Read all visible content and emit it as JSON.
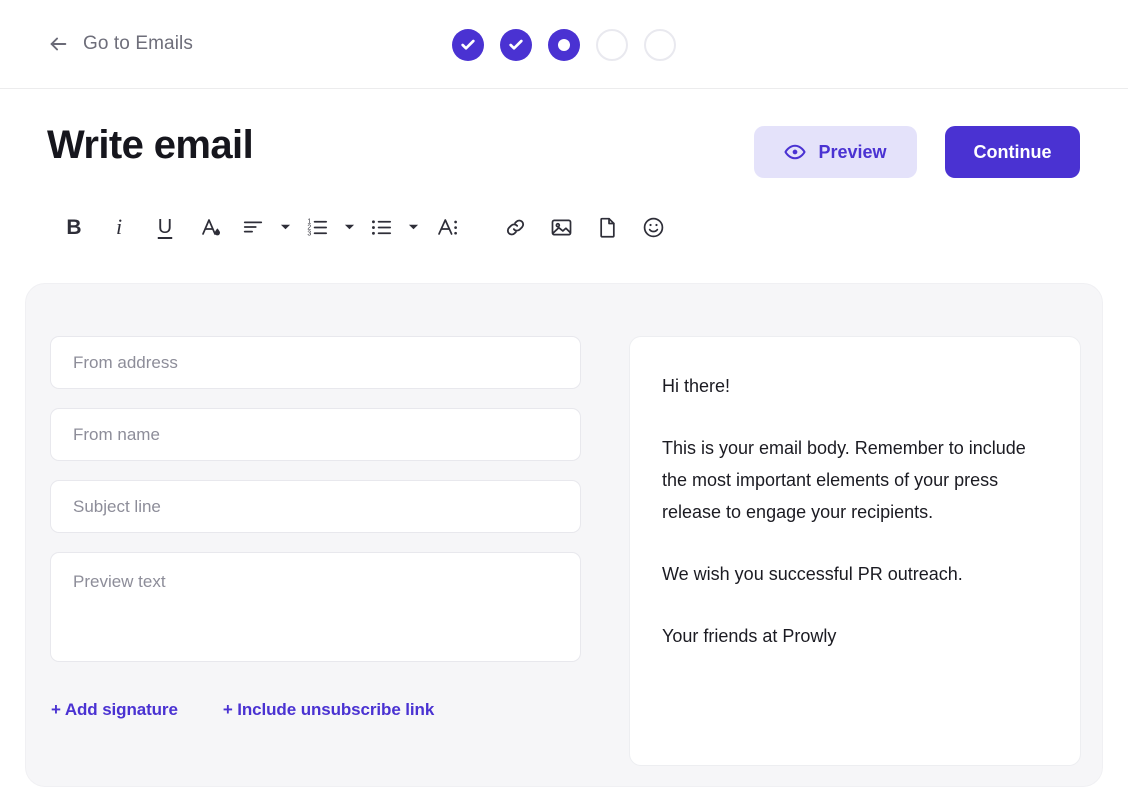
{
  "header": {
    "back_label": "Go to Emails",
    "back_icon": "arrow-left-icon",
    "steps": [
      {
        "state": "done",
        "icon": "check-icon"
      },
      {
        "state": "done",
        "icon": "check-icon"
      },
      {
        "state": "active",
        "icon": "dot-icon"
      },
      {
        "state": "todo",
        "icon": ""
      },
      {
        "state": "todo",
        "icon": ""
      }
    ]
  },
  "page": {
    "title": "Write email"
  },
  "actions": {
    "preview_label": "Preview",
    "preview_icon": "eye-icon",
    "continue_label": "Continue"
  },
  "toolbar": {
    "items": [
      {
        "name": "bold",
        "glyph": "B",
        "icon": "bold-icon"
      },
      {
        "name": "italic",
        "glyph": "i",
        "icon": "italic-icon"
      },
      {
        "name": "underline",
        "glyph": "U",
        "icon": "underline-icon"
      },
      {
        "name": "text-color",
        "glyph": "A",
        "icon": "text-color-icon"
      },
      {
        "name": "align",
        "glyph": "",
        "icon": "align-left-icon"
      },
      {
        "name": "numbered-list",
        "glyph": "",
        "icon": "numbered-list-icon"
      },
      {
        "name": "bulleted-list",
        "glyph": "",
        "icon": "bulleted-list-icon"
      },
      {
        "name": "font-size",
        "glyph": "A",
        "icon": "font-size-icon"
      },
      {
        "name": "link",
        "glyph": "",
        "icon": "link-icon"
      },
      {
        "name": "image",
        "glyph": "",
        "icon": "image-icon"
      },
      {
        "name": "file",
        "glyph": "",
        "icon": "file-icon"
      },
      {
        "name": "emoji",
        "glyph": "",
        "icon": "emoji-icon"
      }
    ]
  },
  "form": {
    "from_address": {
      "value": "",
      "placeholder": "From address"
    },
    "from_name": {
      "value": "",
      "placeholder": "From name"
    },
    "subject": {
      "value": "",
      "placeholder": "Subject line"
    },
    "preview_text": {
      "value": "",
      "placeholder": "Preview text"
    },
    "add_signature_label": "+ Add signature",
    "include_unsubscribe_label": "+ Include unsubscribe link"
  },
  "email_preview": {
    "paragraphs": [
      "Hi there!",
      "This is your email body. Remember to include the most important elements of your press release to engage your recipients.",
      "We wish you successful PR outreach.",
      "Your friends at Prowly"
    ]
  },
  "colors": {
    "accent": "#4a32d2",
    "accent_soft": "#e4e2fa",
    "workspace_bg": "#f6f6f8",
    "text": "#16161d",
    "muted": "#8d8d99"
  }
}
